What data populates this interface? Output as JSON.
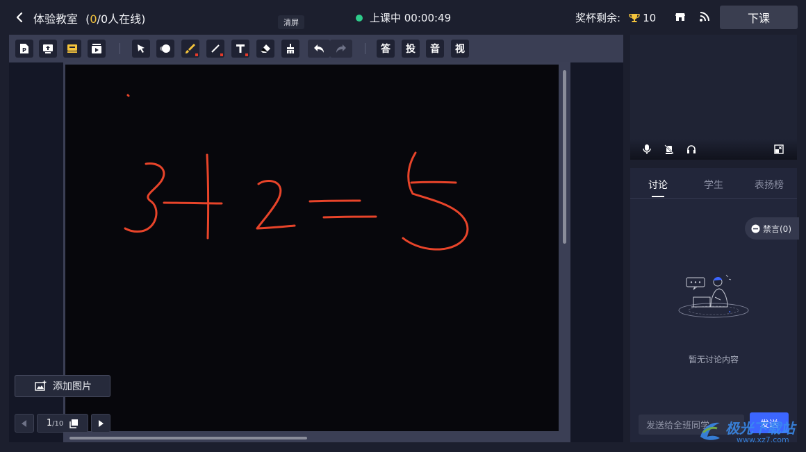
{
  "header": {
    "title_prefix": "体验教室",
    "title_open": "(",
    "online_count": "0",
    "online_suffix": "/0人在线)",
    "status": "上课中 00:00:49",
    "trophy_label": "奖杯剩余:",
    "trophy_count": "10",
    "end_button": "下课"
  },
  "tooltip": "清屏",
  "toolbar": {
    "tools": [
      {
        "name": "ppt-icon"
      },
      {
        "name": "upload-icon"
      },
      {
        "name": "courseware-icon"
      },
      {
        "name": "media-icon"
      },
      {
        "name": "pointer-icon"
      },
      {
        "name": "laser-icon"
      },
      {
        "name": "brush-icon"
      },
      {
        "name": "line-icon"
      },
      {
        "name": "text-icon"
      },
      {
        "name": "eraser-icon"
      },
      {
        "name": "clear-screen-icon"
      },
      {
        "name": "undo-icon"
      },
      {
        "name": "redo-icon"
      }
    ],
    "quick": [
      "答",
      "投",
      "音",
      "视"
    ]
  },
  "board": {
    "add_image": "添加图片",
    "page_current": "1",
    "page_total": "/10",
    "ink_color": "#e8442a"
  },
  "chat": {
    "tabs": [
      "讨论",
      "学生",
      "表扬榜"
    ],
    "mute_label": "禁言(0)",
    "empty_text": "暂无讨论内容",
    "input_placeholder": "发送给全班同学",
    "send_label": "发送"
  },
  "watermark": {
    "title": "极光下载站",
    "url": "www.xz7.com"
  },
  "colors": {
    "accent": "#3c66ff",
    "live": "#2ecc8b",
    "highlight": "#f5c43c"
  }
}
